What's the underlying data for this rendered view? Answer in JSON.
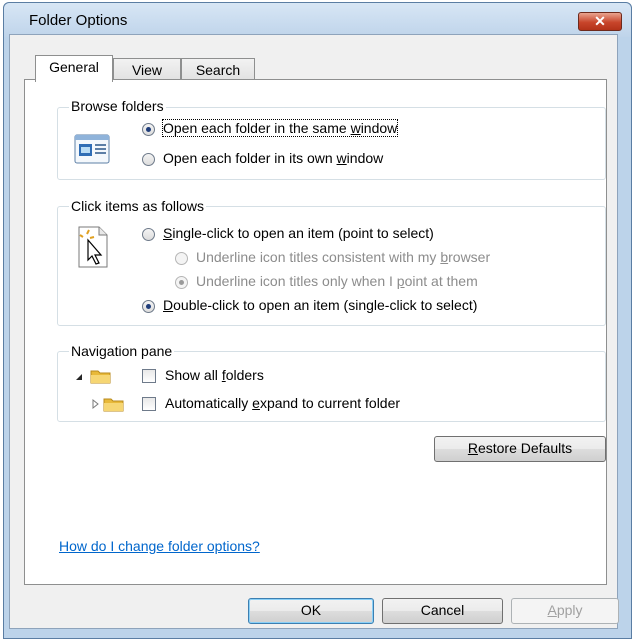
{
  "window": {
    "title": "Folder Options",
    "close_label": "✕"
  },
  "tabs": [
    {
      "label": "General",
      "active": true
    },
    {
      "label": "View",
      "active": false
    },
    {
      "label": "Search",
      "active": false
    }
  ],
  "browse": {
    "group_label": "Browse folders",
    "same_window": {
      "pre": "Open each folder in the same ",
      "u": "w",
      "post": "indow",
      "checked": true
    },
    "own_window": {
      "pre": "Open each folder in its own ",
      "u": "w",
      "post": "indow",
      "checked": false
    }
  },
  "click": {
    "group_label": "Click items as follows",
    "single": {
      "u": "S",
      "post": "ingle-click to open an item (point to select)",
      "checked": false
    },
    "underline_browser": {
      "pre": "Underline icon titles consistent with my ",
      "u": "b",
      "post": "rowser",
      "checked": false,
      "enabled": false
    },
    "underline_point": {
      "pre": "Underline icon titles only when I ",
      "u": "p",
      "post": "oint at them",
      "checked": true,
      "enabled": false
    },
    "double": {
      "u": "D",
      "post": "ouble-click to open an item (single-click to select)",
      "checked": true
    }
  },
  "nav": {
    "group_label": "Navigation pane",
    "show_all": {
      "pre": "Show all ",
      "u": "f",
      "post": "olders",
      "checked": false
    },
    "auto_expand": {
      "pre": "Automatically ",
      "u": "e",
      "post": "xpand to current folder",
      "checked": false
    }
  },
  "restore": {
    "u": "R",
    "post": "estore Defaults"
  },
  "help_link": "How do I change folder options?",
  "buttons": {
    "ok": "OK",
    "cancel": "Cancel",
    "apply": {
      "u": "A",
      "post": "pply"
    }
  },
  "colors": {
    "link": "#0066cc",
    "frame": "#bcd3ea",
    "close": "#c8452b"
  }
}
